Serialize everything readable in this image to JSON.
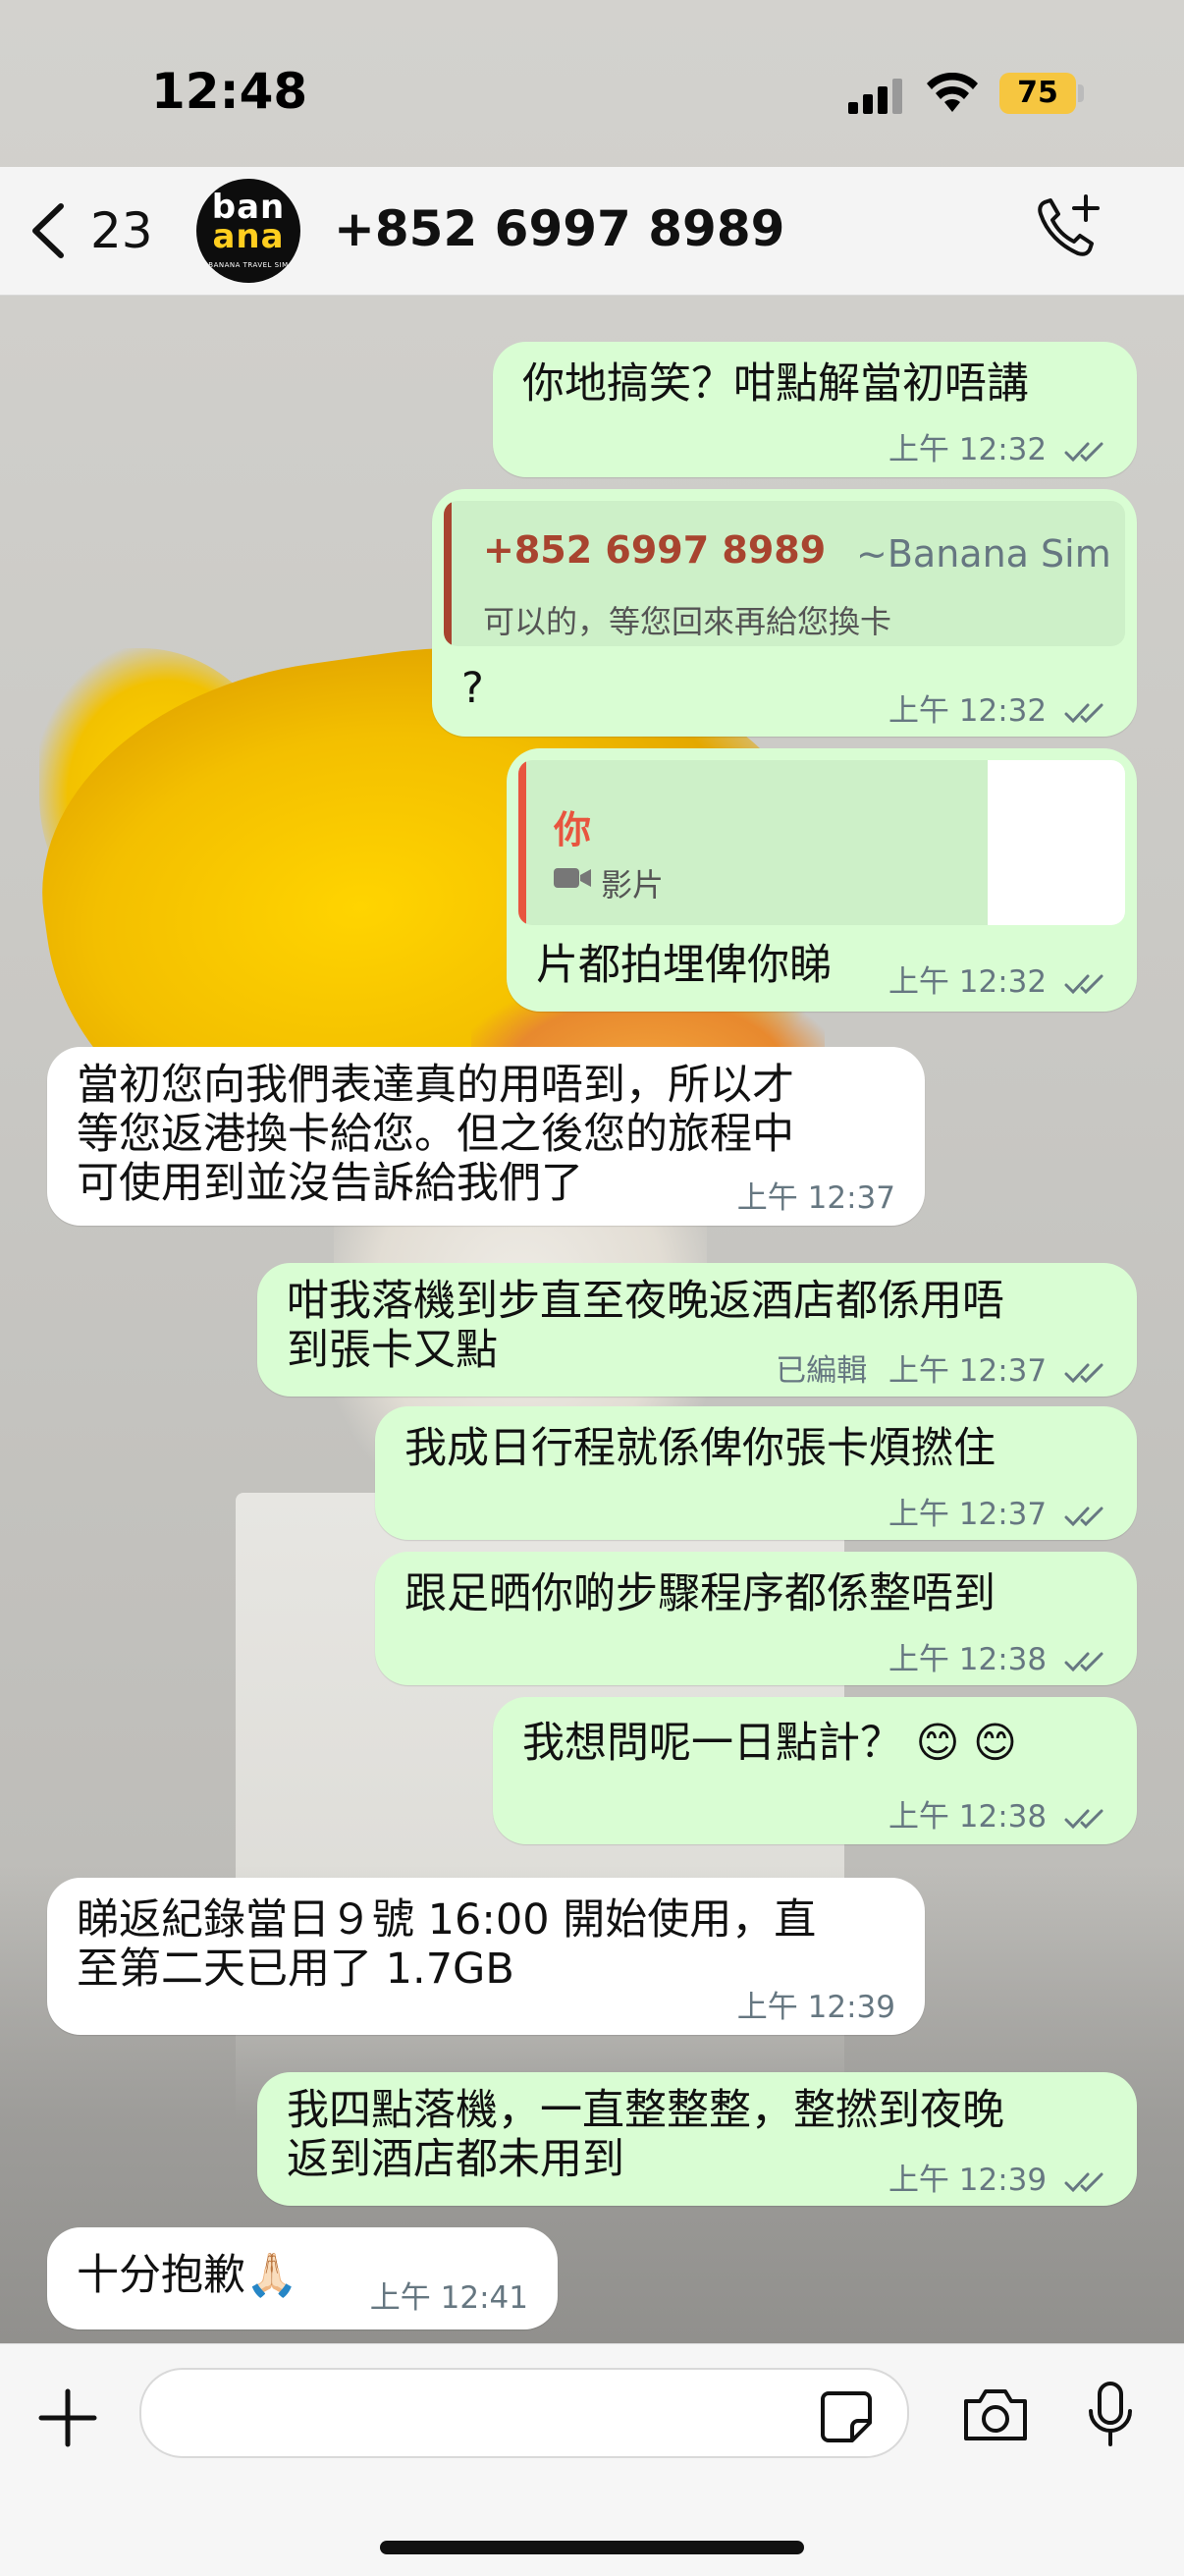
{
  "status": {
    "time": "12:48",
    "battery": "75"
  },
  "header": {
    "back_count": "23",
    "contact": "+852 6997 8989",
    "avatar_text_1": "ban",
    "avatar_text_2": "ana",
    "avatar_tagline": "BANANA TRAVEL SIM"
  },
  "messages": [
    {
      "dir": "out",
      "text": "你地搞笑？咁點解當初唔講",
      "time": "上午 12:32"
    },
    {
      "dir": "out",
      "quote_name": "+852 6997 8989",
      "quote_alias": "~Banana Sim",
      "quote_text": "可以的，等您回來再給您換卡",
      "text": "?",
      "time": "上午 12:32"
    },
    {
      "dir": "out",
      "quote_name": "你",
      "quote_text": "影片",
      "text": "片都拍埋俾你睇",
      "time": "上午 12:32"
    },
    {
      "dir": "in",
      "text": "當初您向我們表達真的用唔到，所以才\n等您返港換卡給您。但之後您的旅程中\n可使用到並沒告訴給我們了",
      "time": "上午 12:37"
    },
    {
      "dir": "out",
      "text": "咁我落機到步直至夜晚返酒店都係用唔\n到張卡又點",
      "edited": "已編輯",
      "time": "上午 12:37"
    },
    {
      "dir": "out",
      "text": "我成日行程就係俾你張卡煩撚住",
      "time": "上午 12:37"
    },
    {
      "dir": "out",
      "text": "跟足晒你啲步驟程序都係整唔到",
      "time": "上午 12:38"
    },
    {
      "dir": "out",
      "text": "我想問呢一日點計？ 😊 😊",
      "time": "上午 12:38"
    },
    {
      "dir": "in",
      "text": "睇返紀錄當日９號 16:00 開始使用，直\n至第二天已用了 1.7GB",
      "time": "上午 12:39"
    },
    {
      "dir": "out",
      "text": "我四點落機，一直整整整，整撚到夜晚\n返到酒店都未用到",
      "time": "上午 12:39"
    },
    {
      "dir": "in",
      "text": "十分抱歉🙏🏻",
      "time": "上午 12:41"
    }
  ],
  "colors": {
    "out_bubble": "#d9fdd3",
    "in_bubble": "#ffffff",
    "quote_red": "#a8442f",
    "quote_you": "#e8553f",
    "tick": "#667781"
  },
  "icons": [
    "back-chevron-icon",
    "add-call-icon",
    "plus-icon",
    "sticker-icon",
    "camera-icon",
    "microphone-icon",
    "video-icon",
    "double-check-icon"
  ]
}
